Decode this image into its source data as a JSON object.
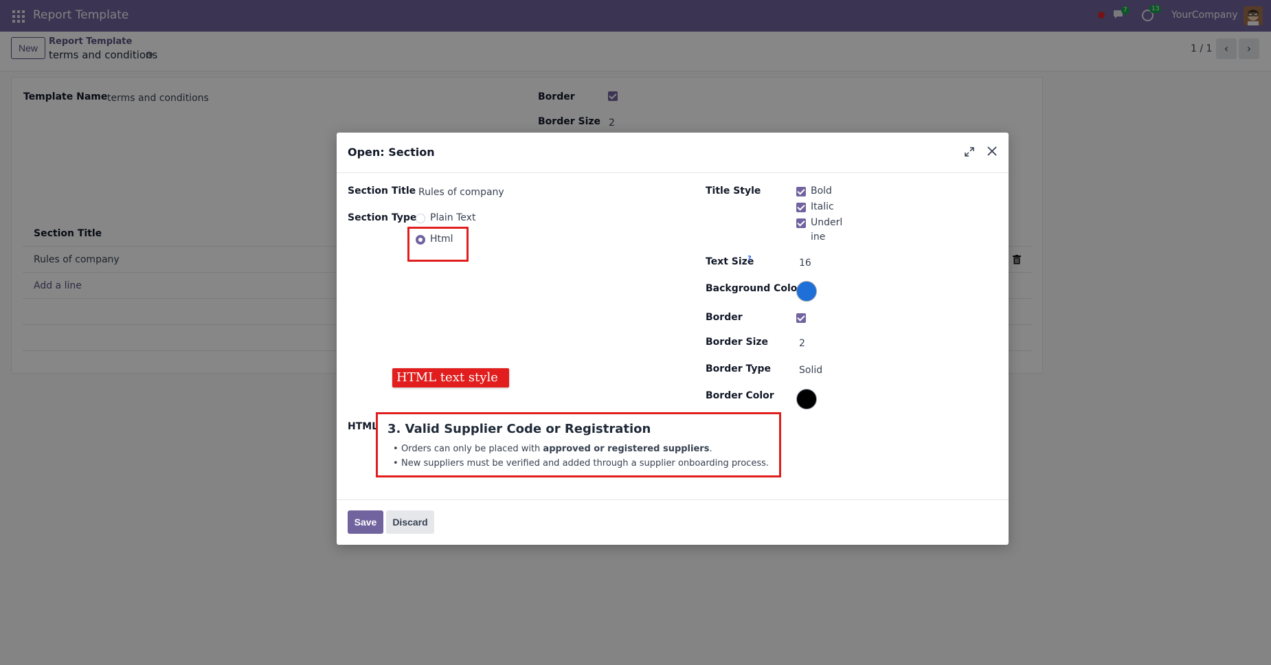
{
  "navbar": {
    "app_title": "Report Template",
    "company": "YourCompany",
    "messages_count": "7",
    "activities_count": "13"
  },
  "control_panel": {
    "new_label": "New",
    "breadcrumb_parent": "Report Template",
    "breadcrumb_current": "terms and conditions",
    "pager_value": "1 / 1"
  },
  "form": {
    "template_name_label": "Template Name",
    "template_name_value": "terms and conditions",
    "border_label": "Border",
    "border_size_label": "Border Size",
    "border_size_value": "2",
    "lines_header": "Section Title",
    "lines": [
      "Rules of company"
    ],
    "add_line_label": "Add a line"
  },
  "modal": {
    "title": "Open: Section",
    "section_title_label": "Section Title",
    "section_title_value": "Rules of company",
    "section_type_label": "Section Type",
    "section_type_options": [
      "Plain Text",
      "Html"
    ],
    "section_type_selected": "Html",
    "title_style_label": "Title Style",
    "title_style_options": [
      "Bold",
      "Italic",
      "Underl",
      "ine"
    ],
    "text_size_label": "Text Size",
    "text_size_tooltip": "?",
    "text_size_value": "16",
    "background_color_label": "Background Color",
    "background_color_value": "#1f6fd8",
    "border_label": "Border",
    "border_size_label": "Border Size",
    "border_size_value": "2",
    "border_type_label": "Border Type",
    "border_type_value": "Solid",
    "border_color_label": "Border Color",
    "border_color_value": "#000000",
    "html_label": "HTML",
    "annotation": "HTML text style",
    "html_content": {
      "heading": "3. Valid Supplier Code or Registration",
      "bullet1_pre": "Orders can only be placed with ",
      "bullet1_bold": "approved or registered suppliers",
      "bullet1_post": ".",
      "bullet2": "New suppliers must be verified and added through a supplier onboarding process."
    },
    "save_label": "Save",
    "discard_label": "Discard"
  },
  "colors": {
    "brand": "#71639e",
    "highlight": "#e11d1d"
  }
}
